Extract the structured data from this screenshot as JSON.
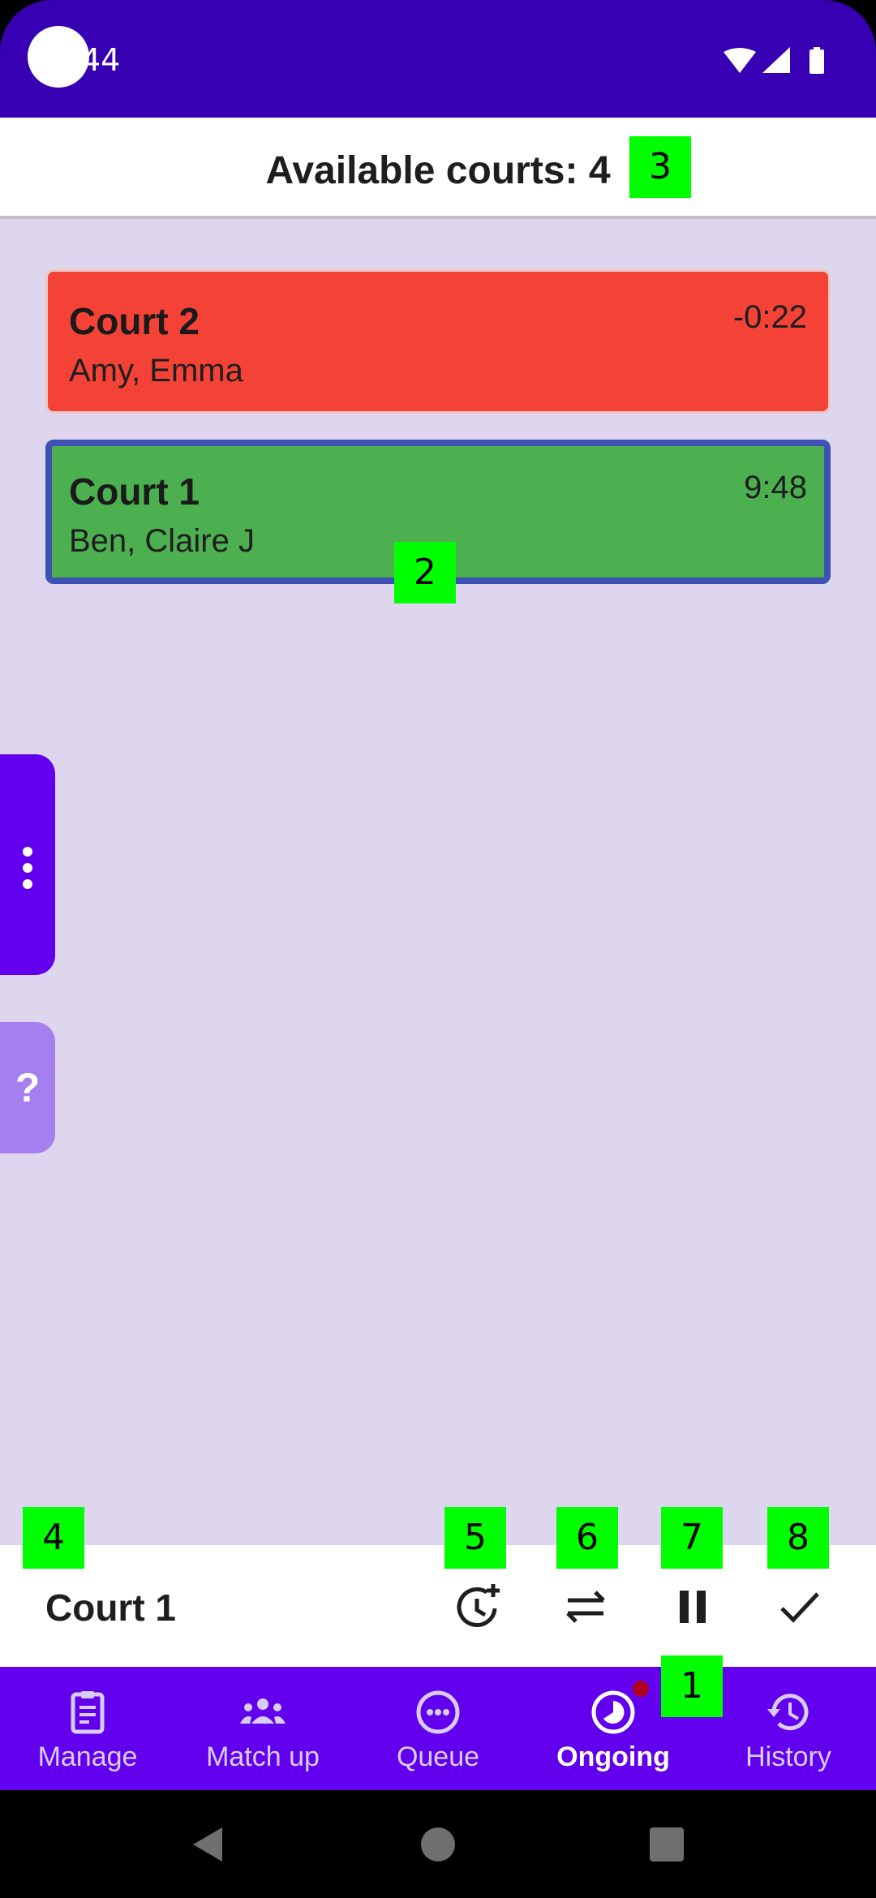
{
  "status_bar": {
    "time": "44"
  },
  "header": {
    "title": "Available courts: 4"
  },
  "courts": [
    {
      "name": "Court 2",
      "players": "Amy, Emma",
      "timer": "-0:22",
      "color": "#f44336"
    },
    {
      "name": "Court 1",
      "players": "Ben, Claire J",
      "timer": "9:48",
      "color": "#4caf50",
      "selected": true
    }
  ],
  "side": {
    "help_label": "?"
  },
  "action_bar": {
    "title": "Court 1",
    "buttons": [
      "add-time",
      "swap",
      "pause",
      "complete"
    ]
  },
  "bottom_nav": {
    "items": [
      {
        "label": "Manage",
        "icon": "clipboard-icon"
      },
      {
        "label": "Match up",
        "icon": "group-icon"
      },
      {
        "label": "Queue",
        "icon": "more-circle-icon"
      },
      {
        "label": "Ongoing",
        "icon": "timelapse-icon",
        "active": true
      },
      {
        "label": "History",
        "icon": "history-icon"
      }
    ]
  },
  "markers": [
    "1",
    "2",
    "3",
    "4",
    "5",
    "6",
    "7",
    "8"
  ],
  "colors": {
    "status_bar": "#3700b3",
    "primary": "#6200ee",
    "background": "#ded6ef",
    "marker": "#00ff00"
  }
}
